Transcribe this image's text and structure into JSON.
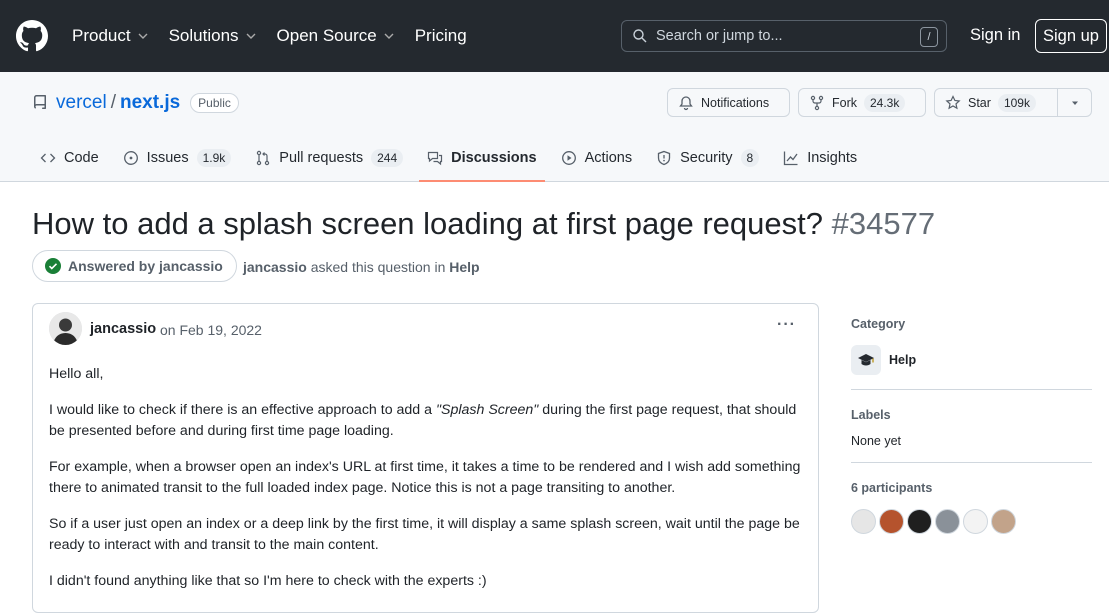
{
  "header": {
    "nav": [
      {
        "label": "Product",
        "dropdown": true,
        "icon": "chevron-down-icon"
      },
      {
        "label": "Solutions",
        "dropdown": true,
        "icon": "chevron-down-icon"
      },
      {
        "label": "Open Source",
        "dropdown": true,
        "icon": "chevron-down-icon"
      },
      {
        "label": "Pricing",
        "dropdown": false
      }
    ],
    "search_placeholder": "Search or jump to...",
    "search_shortcut": "/",
    "sign_in": "Sign in",
    "sign_up": "Sign up"
  },
  "repo": {
    "owner": "vercel",
    "separator": "/",
    "name": "next.js",
    "visibility": "Public",
    "notifications_label": "Notifications",
    "fork_label": "Fork",
    "fork_count": "24.3k",
    "star_label": "Star",
    "star_count": "109k"
  },
  "tabs": [
    {
      "label": "Code",
      "icon": "code-icon",
      "count": null
    },
    {
      "label": "Issues",
      "icon": "issue-icon",
      "count": "1.9k"
    },
    {
      "label": "Pull requests",
      "icon": "pull-request-icon",
      "count": "244"
    },
    {
      "label": "Discussions",
      "icon": "discussion-icon",
      "count": null,
      "selected": true
    },
    {
      "label": "Actions",
      "icon": "play-icon",
      "count": null
    },
    {
      "label": "Security",
      "icon": "shield-icon",
      "count": "8"
    },
    {
      "label": "Insights",
      "icon": "graph-icon",
      "count": null
    }
  ],
  "discussion": {
    "title": "How to add a splash screen loading at first page request?",
    "number": "#34577",
    "answered_label": "Answered by jancassio",
    "asker": "jancassio",
    "asked_text": "asked this question in",
    "category_link": "Help"
  },
  "post": {
    "author": "jancassio",
    "date": "on Feb 19, 2022",
    "more": "···",
    "paragraphs": [
      "Hello all,",
      "I would like to check if there is an effective approach to add a ",
      "For example, when a browser open an index's URL at first time, it takes a time to be rendered and I wish add something there to animated transit to the full loaded index page. Notice this is not a page transiting to another.",
      "So if a user just open an index or a deep link by the first time, it will display a same splash screen, wait until the page be ready to interact with and transit to the main content.",
      "I didn't found anything like that so I'm here to check with the experts :)"
    ],
    "p2_emphasis": "\"Splash Screen\"",
    "p2_rest": " during the first page request, that should be presented before and during first time page loading."
  },
  "sidebar": {
    "category_heading": "Category",
    "category_name": "Help",
    "category_icon": "graduation-cap-icon",
    "labels_heading": "Labels",
    "labels_value": "None yet",
    "participants_heading": "6 participants",
    "participant_colors": [
      "#e6e6e6",
      "#b5532d",
      "#1f1f1f",
      "#8a9199",
      "#f3f3f3",
      "#c2a38a"
    ]
  },
  "colors": {
    "header_bg": "#24292f",
    "link": "#0969da",
    "tab_underline": "#fd8c73",
    "answered_check": "#1a7f37"
  }
}
